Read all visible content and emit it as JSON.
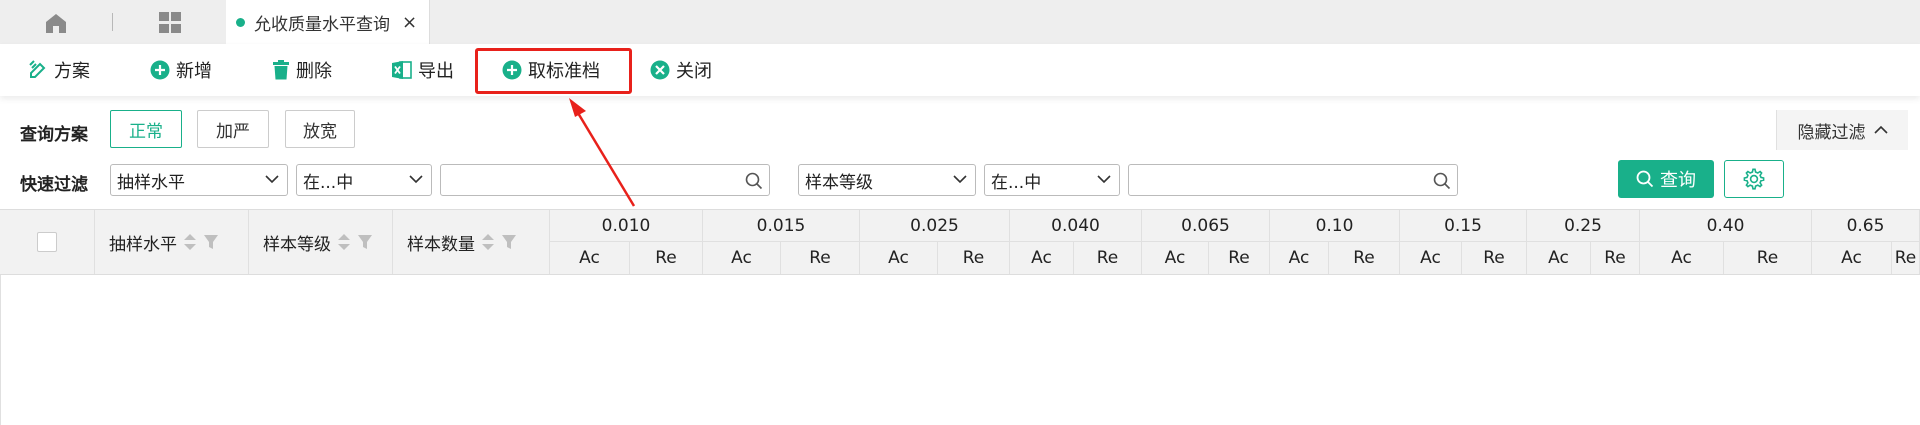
{
  "tabs": [
    {
      "title": "允收质量水平查询",
      "close": "×"
    }
  ],
  "toolbar": {
    "plan": "方案",
    "add": "新增",
    "delete": "删除",
    "export": "导出",
    "cancel_standard": "取标准档",
    "close": "关闭"
  },
  "plan_row": {
    "label": "查询方案",
    "options": [
      "正常",
      "加严",
      "放宽"
    ],
    "active": "正常",
    "hide_filter": "隐藏过滤"
  },
  "filter_row": {
    "label": "快速过滤",
    "field1": "抽样水平",
    "op1": "在...中",
    "field2": "样本等级",
    "op2": "在...中",
    "query": "查询"
  },
  "table": {
    "fixed_headers": [
      "抽样水平",
      "样本等级",
      "样本数量"
    ],
    "levels": [
      "0.010",
      "0.015",
      "0.025",
      "0.040",
      "0.065",
      "0.10",
      "0.15",
      "0.25",
      "0.40",
      "0.65"
    ],
    "sub_ac": "Ac",
    "sub_re": "Re"
  },
  "colors": {
    "accent": "#19b08a",
    "highlight": "#e8211b",
    "header_bg": "#f2f2f2"
  }
}
